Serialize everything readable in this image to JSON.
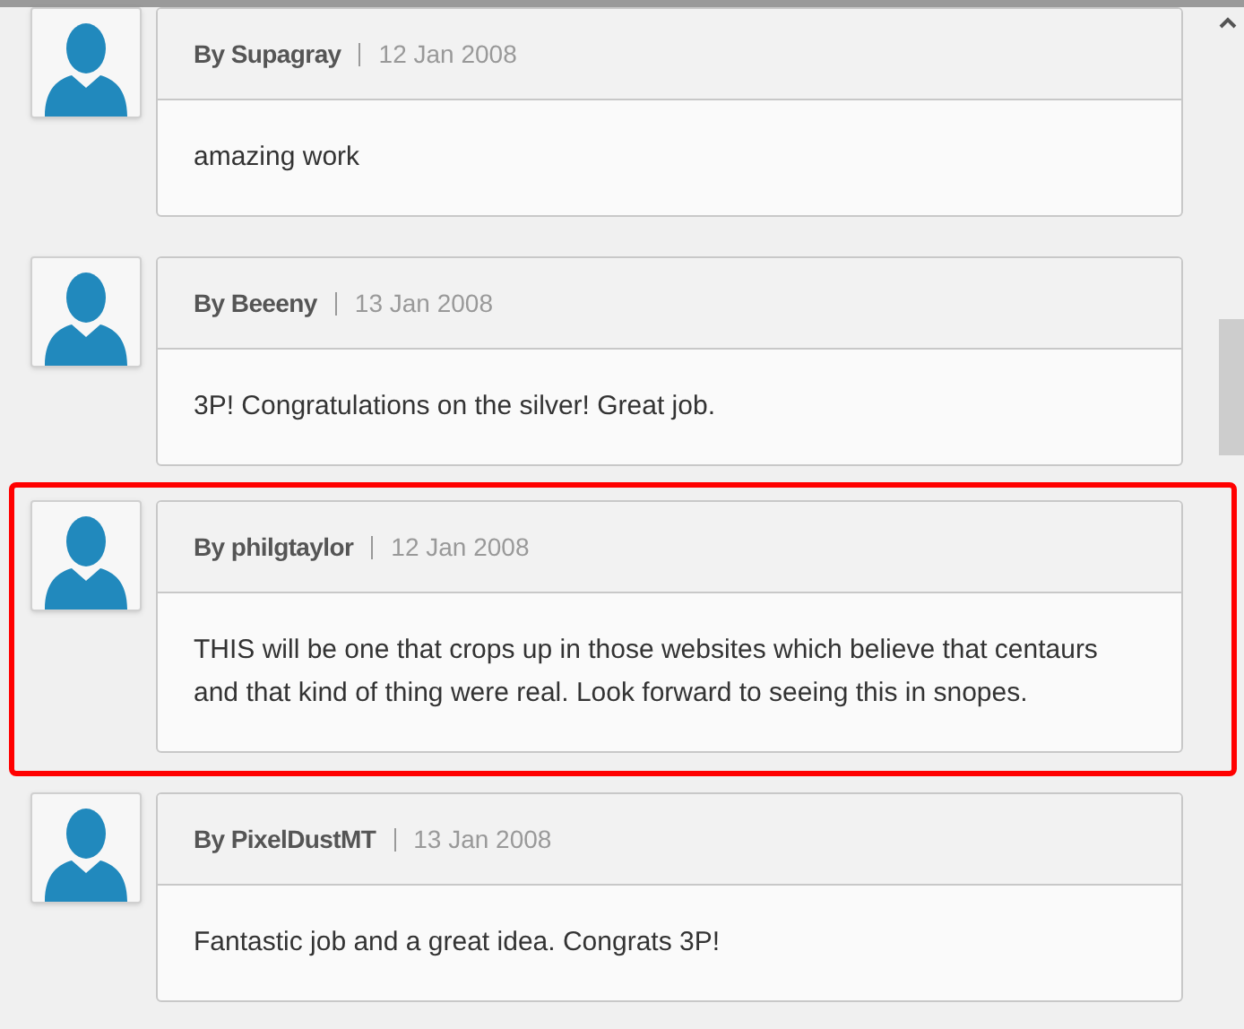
{
  "comments": [
    {
      "author": "By Supagray",
      "date": "12 Jan 2008",
      "text": "amazing work",
      "highlighted": false
    },
    {
      "author": "By Beeeny",
      "date": "13 Jan 2008",
      "text": "3P! Congratulations on the silver! Great job.",
      "highlighted": false
    },
    {
      "author": "By philgtaylor",
      "date": "12 Jan 2008",
      "text": "THIS will be one that crops up in those websites which believe that centaurs and that kind of thing were real. Look forward to seeing this in snopes.",
      "highlighted": true
    },
    {
      "author": "By PixelDustMT",
      "date": "13 Jan 2008",
      "text": "Fantastic job and a great idea. Congrats 3P!",
      "highlighted": false
    }
  ]
}
